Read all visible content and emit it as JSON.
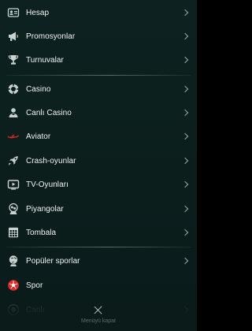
{
  "menu": {
    "group1": [
      {
        "label": "Hesap",
        "icon": "id-card-icon",
        "chevron": true
      },
      {
        "label": "Promosyonlar",
        "icon": "megaphone-icon",
        "chevron": true
      },
      {
        "label": "Turnuvalar",
        "icon": "trophy-icon",
        "chevron": true
      }
    ],
    "group2": [
      {
        "label": "Casino",
        "icon": "casino-chip-icon",
        "chevron": true
      },
      {
        "label": "Canlı Casino",
        "icon": "live-dealer-icon",
        "chevron": true
      },
      {
        "label": "Aviator",
        "icon": "aviator-plane-icon",
        "chevron": true
      },
      {
        "label": "Crash-oyunlar",
        "icon": "rocket-icon",
        "chevron": true
      },
      {
        "label": "TV-Oyunları",
        "icon": "tv-icon",
        "chevron": true
      },
      {
        "label": "Piyangolar",
        "icon": "lottery-balls-icon",
        "chevron": true
      },
      {
        "label": "Tombala",
        "icon": "bingo-card-icon",
        "chevron": true
      }
    ],
    "group3": [
      {
        "label": "Popüler sporlar",
        "icon": "globe-sports-icon",
        "chevron": true
      },
      {
        "label": "Spor",
        "icon": "soccer-ball-icon",
        "chevron": false
      },
      {
        "label": "Canlı",
        "icon": "live-icon",
        "chevron": true
      }
    ]
  },
  "close": {
    "label": "Menüyü kapat"
  },
  "colors": {
    "background": "#0b1e1c",
    "icon": "#c9d2d0",
    "aviator_red": "#d2282c",
    "soccer_red": "#e02a2a"
  }
}
